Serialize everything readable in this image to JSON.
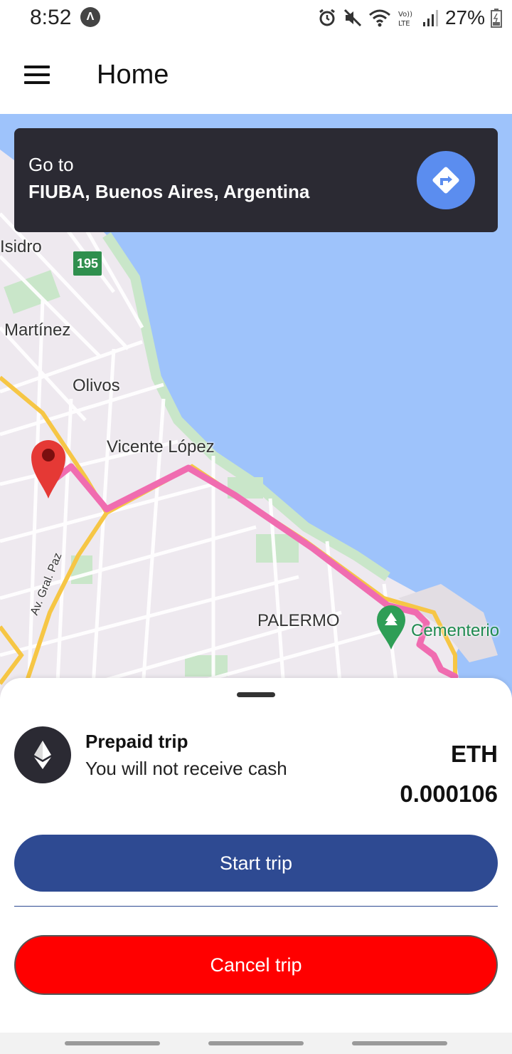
{
  "status_bar": {
    "time": "8:52",
    "battery": "27%",
    "icons": [
      "app-notification-icon",
      "alarm-icon",
      "mute-icon",
      "wifi-icon",
      "volte-icon",
      "signal-icon",
      "battery-icon"
    ]
  },
  "app_bar": {
    "title": "Home",
    "menu_icon": "hamburger-menu-icon"
  },
  "destination": {
    "prefix": "Go to",
    "name": "FIUBA, Buenos Aires, Argentina",
    "directions_icon": "directions-icon"
  },
  "map": {
    "labels": {
      "isidro": "Isidro",
      "martinez": "Martínez",
      "olivos": "Olivos",
      "vicente_lopez": "Vicente López",
      "palermo": "PALERMO",
      "gral_paz": "Av. Gral. Paz",
      "cementerio": "Cementerio"
    },
    "road_badge": "195",
    "colors": {
      "water": "#9ec3fb",
      "land": "#eee9ef",
      "park": "#c9e6c9",
      "highway": "#f6c645",
      "route": "#f06cb0"
    }
  },
  "trip": {
    "title": "Prepaid trip",
    "subtitle": "You will not receive cash",
    "currency": "ETH",
    "amount": "0.000106",
    "icon": "ethereum-icon"
  },
  "actions": {
    "start_label": "Start trip",
    "cancel_label": "Cancel trip"
  },
  "colors": {
    "card_bg": "#2b2a33",
    "directions_btn": "#5b8def",
    "start_btn": "#2e4a92",
    "cancel_btn": "#ff0000"
  }
}
